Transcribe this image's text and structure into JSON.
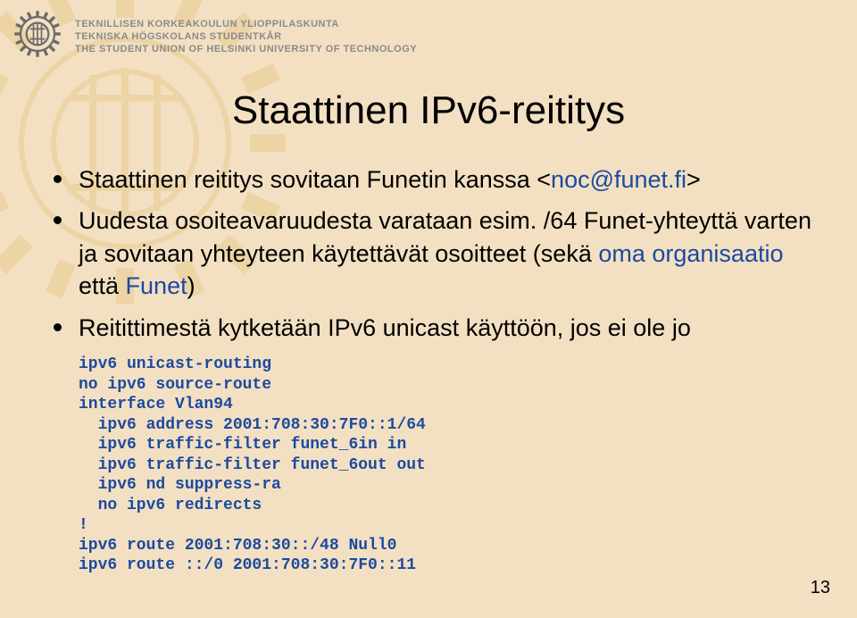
{
  "header": {
    "line1": "TEKNILLISEN KORKEAKOULUN YLIOPPILASKUNTA",
    "line2": "TEKNISKA HÖGSKOLANS STUDENTKÅR",
    "line3": "THE STUDENT UNION OF HELSINKI UNIVERSITY OF TECHNOLOGY"
  },
  "title": "Staattinen IPv6-reititys",
  "bullets": {
    "b1_pre": "Staattinen reititys sovitaan Funetin kanssa <",
    "b1_link": "noc@funet.fi",
    "b1_post": ">",
    "b2": "Uudesta osoiteavaruudesta varataan esim. /64 Funet-yhteyttä varten ja sovitaan yhteyteen käytettävät osoitteet (sekä ",
    "b2_blue1": "oma organisaatio",
    "b2_mid": " että ",
    "b2_blue2": "Funet",
    "b2_end": ")",
    "b3": "Reitittimestä kytketään IPv6 unicast käyttöön, jos ei ole jo"
  },
  "code": "ipv6 unicast-routing\nno ipv6 source-route\ninterface Vlan94\n  ipv6 address 2001:708:30:7F0::1/64\n  ipv6 traffic-filter funet_6in in\n  ipv6 traffic-filter funet_6out out\n  ipv6 nd suppress-ra\n  no ipv6 redirects\n!\nipv6 route 2001:708:30::/48 Null0\nipv6 route ::/0 2001:708:30:7F0::11",
  "page_number": "13"
}
